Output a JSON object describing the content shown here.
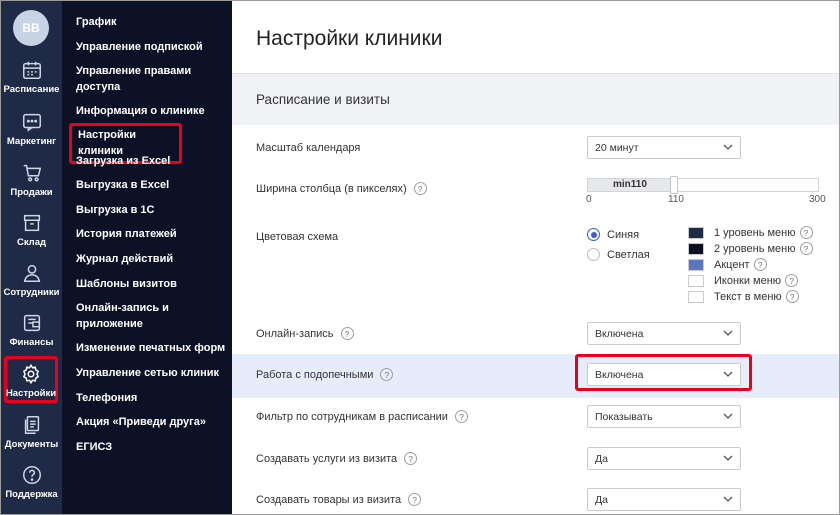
{
  "user": {
    "initials": "BB"
  },
  "rail": [
    {
      "label": "Расписание",
      "icon": "calendar-icon"
    },
    {
      "label": "Маркетинг",
      "icon": "chat-icon"
    },
    {
      "label": "Продажи",
      "icon": "cart-icon"
    },
    {
      "label": "Склад",
      "icon": "box-icon"
    },
    {
      "label": "Сотрудники",
      "icon": "person-icon"
    },
    {
      "label": "Финансы",
      "icon": "wallet-icon"
    },
    {
      "label": "Настройки",
      "icon": "gear-icon"
    },
    {
      "label": "Документы",
      "icon": "documents-icon"
    },
    {
      "label": "Поддержка",
      "icon": "question-icon"
    }
  ],
  "menu": [
    "График",
    "Управление подпиской",
    "Управление правами доступа",
    "Информация о клинике",
    "Настройки клиники",
    "Загрузка из Excel",
    "Выгрузка в Excel",
    "Выгрузка в 1С",
    "История платежей",
    "Журнал действий",
    "Шаблоны визитов",
    "Онлайн-запись и приложение",
    "Изменение печатных форм",
    "Управление сетью клиник",
    "Телефония",
    "Акция «Приведи друга»",
    "ЕГИСЗ"
  ],
  "page": {
    "title": "Настройки клиники",
    "section": "Расписание и визиты"
  },
  "settings": {
    "calendar_scale": {
      "label": "Масштаб календаря",
      "value": "20 минут"
    },
    "column_width": {
      "label": "Ширина столбца (в пикселях)",
      "value_label": "min110",
      "value": 110,
      "min": 0,
      "max": 300,
      "ticks": [
        "0",
        "110",
        "300"
      ]
    },
    "color_scheme": {
      "label": "Цветовая схема",
      "options": [
        {
          "label": "Синяя",
          "checked": true
        },
        {
          "label": "Светлая",
          "checked": false
        }
      ],
      "swatches": [
        {
          "label": "1 уровень меню",
          "color": "#1f2b46"
        },
        {
          "label": "2 уровень меню",
          "color": "#0d1125"
        },
        {
          "label": "Акцент",
          "color": "#5c77bd"
        },
        {
          "label": "Иконки меню",
          "color": "#ffffff"
        },
        {
          "label": "Текст в меню",
          "color": "#ffffff"
        }
      ]
    },
    "online_booking": {
      "label": "Онлайн-запись",
      "value": "Включена"
    },
    "wards": {
      "label": "Работа с подопечными",
      "value": "Включена"
    },
    "staff_filter": {
      "label": "Фильтр по сотрудникам в расписании",
      "value": "Показывать"
    },
    "services_from_visit": {
      "label": "Создавать услуги из визита",
      "value": "Да"
    },
    "goods_from_visit": {
      "label": "Создавать товары из визита",
      "value": "Да"
    }
  },
  "help_mark": "?",
  "colors": {
    "rail": "#1f2b46",
    "menu": "#0d1125",
    "highlight": "#e8001c",
    "accent": "#3b5bdb"
  }
}
